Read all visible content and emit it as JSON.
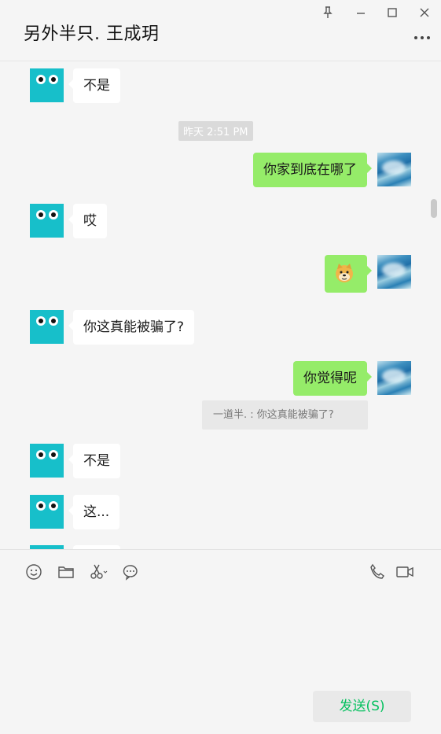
{
  "window": {
    "title": "另外半只. 王成玥",
    "pin_icon": "pin-icon",
    "minimize_icon": "minimize-icon",
    "maximize_icon": "maximize-icon",
    "close_icon": "close-icon",
    "more_icon": "more-dots-icon"
  },
  "chat": {
    "timestamp": "昨天 2:51 PM",
    "messages": [
      {
        "side": "left",
        "text": "不是"
      },
      {
        "side": "right",
        "text": "你家到底在哪了"
      },
      {
        "side": "left",
        "text": "哎"
      },
      {
        "side": "right",
        "sticker": "doge-emoji"
      },
      {
        "side": "left",
        "text": "你这真能被骗了?"
      },
      {
        "side": "right",
        "text": "你觉得呢"
      },
      {
        "side": "left",
        "text": "不是"
      },
      {
        "side": "left",
        "text": "这..."
      }
    ],
    "quote": "一道半. : 你这真能被骗了?"
  },
  "toolbar": {
    "icons": [
      "emoji-icon",
      "folder-icon",
      "scissors-icon",
      "chat-bubble-icon",
      "phone-icon",
      "video-icon"
    ]
  },
  "composer": {
    "send_label": "发送(S)"
  },
  "colors": {
    "self_bubble": "#95ec69",
    "other_bubble": "#ffffff",
    "avatar_other": "#17bfca",
    "send_text": "#07c160"
  }
}
